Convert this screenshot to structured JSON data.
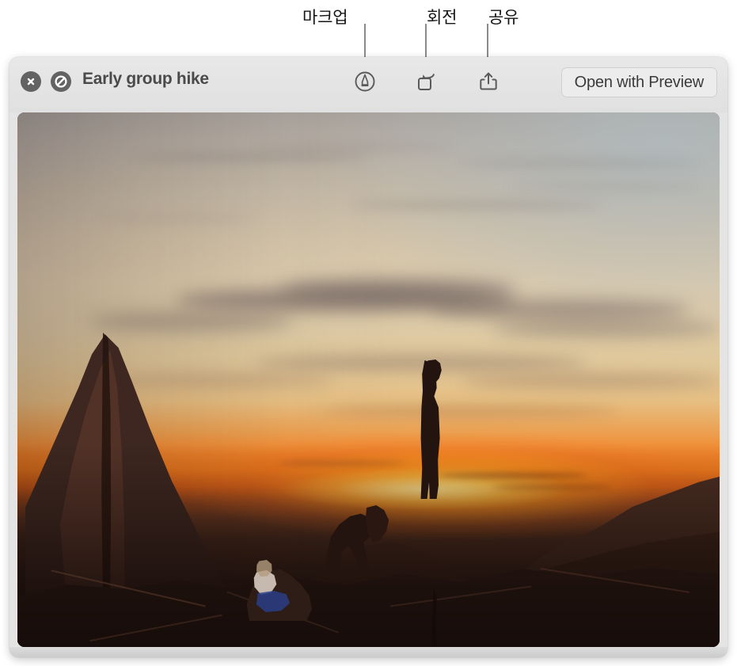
{
  "callouts": [
    {
      "label": "마크업",
      "name": "callout-markup"
    },
    {
      "label": "회전",
      "name": "callout-rotate"
    },
    {
      "label": "공유",
      "name": "callout-share"
    }
  ],
  "window": {
    "title": "Early group hike",
    "buttons": {
      "close": "close-icon",
      "no_markup": "no-markup-icon"
    },
    "toolbar": {
      "markup_tool": "markup-pen-icon",
      "rotate_tool": "rotate-left-icon",
      "share_tool": "share-icon",
      "open_with_label": "Open with Preview"
    }
  },
  "photo": {
    "alt": "Three hikers in silhouette on red sandstone rocks at sunset",
    "subjects": [
      "seated person in white top and blue shorts",
      "crouching person reaching down",
      "standing person looking down"
    ]
  },
  "colors": {
    "window_bg": "#e4e4e4",
    "toolbar_bg": "#e8e8e8",
    "title_text": "#4a4a4a",
    "icon_stroke": "#5a5a5a",
    "button_fill": "#636363",
    "callout_text": "#151515",
    "callout_line": "#8a8a8a",
    "sunset_orange": "#f3842a",
    "sky_gold": "#ddcaa6",
    "rock_dark": "#3a241c"
  }
}
